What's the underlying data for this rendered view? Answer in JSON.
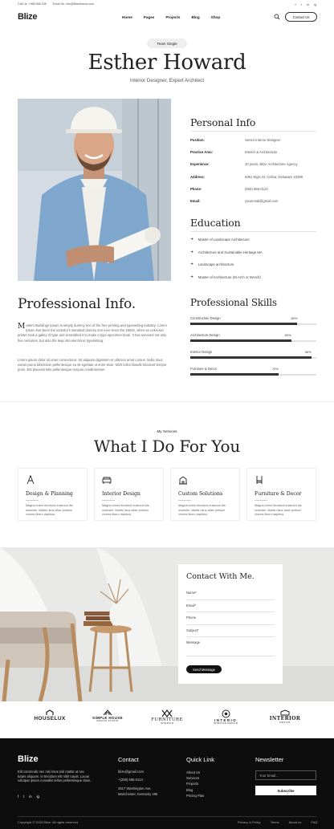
{
  "topbar": {
    "phone": "Call Us: +968 568 208",
    "email": "Email Us: Info@Blizetheme.com",
    "social": [
      "f",
      "t",
      "in",
      "ig"
    ]
  },
  "nav": {
    "logo": "Blize",
    "items": [
      "Home",
      "Pages",
      "Projects",
      "Blog",
      "Shop"
    ],
    "contact_label": "Contact Us"
  },
  "hero": {
    "badge": "Team Single",
    "name": "Esther Howard",
    "subtitle": "Interior Designer, Expert Architect"
  },
  "personal": {
    "title": "Personal Info",
    "rows": [
      {
        "k": "Position:",
        "v": "Senior Interior Designer"
      },
      {
        "k": "Practice Area:",
        "v": "Interior & Architecture"
      },
      {
        "k": "Experience:",
        "v": "10 years, Blize Architecture Agency"
      },
      {
        "k": "Address:",
        "v": "6391 Elgin St. Celina, Delaware 10299"
      },
      {
        "k": "Phone:",
        "v": "(603) 555-0123"
      },
      {
        "k": "Email:",
        "v": "youremail@gmail.com"
      }
    ]
  },
  "education": {
    "title": "Education",
    "items": [
      "Master of Landscape Architecture",
      "Architecture and Sustainable Heritage MA",
      "Landscape architecture",
      "Master of Architecture (M.Arch or MArch)"
    ]
  },
  "professional": {
    "title": "Professional Info.",
    "p1_drop": "M",
    "p1": "odern Buildings Ipsum is simply dummy text of the free printing and typesetting industry. Lorem Ipsum has been the industry's standard dummy text ever since the 1500s, when an unknown printer took a galley of type and scrambled it to make a type specimen book. It has survived not only five centuries, but also the leap into electronic typesetting.",
    "p2": "Lorem ipsum dolor sit amet consectetur. Sit aliquam dignissim et ultricies amet cursus. Nulla risus varius purus bibendum pellentesque eu sit egestas ut enim vitae. Nibh tortor blandit tincidunt tempor proin. Est placerat felis pellentesque tempus condimentum."
  },
  "skills": {
    "title": "Professional Skills",
    "items": [
      {
        "name": "Construction Design",
        "value": 85,
        "label": "85%"
      },
      {
        "name": "Architecture Design",
        "value": 80,
        "label": "80%"
      },
      {
        "name": "Interior Design",
        "value": 96,
        "label": "96%"
      },
      {
        "name": "Furniture & Decor",
        "value": 70,
        "label": "70%"
      }
    ]
  },
  "services": {
    "tag": "My Services",
    "title": "What I Do For You",
    "cards": [
      {
        "title": "Design & Planning",
        "desc": "Magna lorem tincidunt euismod dis molestie. Mattis risus vitae pretium viverra libero dapibus."
      },
      {
        "title": "Interior Design",
        "desc": "Magna lorem tincidunt euismod dis molestie. Mattis risus vitae pretium viverra libero dapibus."
      },
      {
        "title": "Custom Solutions",
        "desc": "Magna lorem tincidunt euismod dis molestie. Mattis risus vitae pretium viverra libero dapibus."
      },
      {
        "title": "Furniture & Decor",
        "desc": "Magna lorem tincidunt euismod dis molestie. Mattis risus vitae pretium viverra libero dapibus."
      }
    ]
  },
  "contact_form": {
    "title": "Contact With Me.",
    "fields": [
      "Name*",
      "Email*",
      "Phone",
      "Subject*",
      "Message"
    ],
    "submit": "Send Message"
  },
  "brands": [
    {
      "name": "HOUSELUX",
      "sub": ""
    },
    {
      "name": "SIMPLE HOUSE",
      "sub": "DESIGN STUDIO"
    },
    {
      "name": "FURNITURE",
      "sub": "INTERIOR"
    },
    {
      "name": "INTERIO",
      "sub": "INTERIOR DESIGN"
    },
    {
      "name": "INTERIOR",
      "sub": "DESIGN"
    }
  ],
  "footer": {
    "logo": "Blize",
    "about": "Elit commodo nec nisi risus nisl mattis ut nec turpis aliquam. In tincidunt elit nibh turpis. Lacus volutpat ipsum convallis tellus pellentesque diam.",
    "contact_title": "Contact",
    "contact": [
      "blize@gmail.com",
      "+(208) 555-0113",
      "4517 Washington Ave.",
      "Manchester, Kentucky 495"
    ],
    "quick_title": "Quick Link",
    "quick": [
      "About Us",
      "Services",
      "Projects",
      "Blog",
      "Pricing Plan"
    ],
    "newsletter_title": "Newsletter",
    "email_placeholder": "Your Email...",
    "subscribe": "Subscribe",
    "copyright": "Copyright © 2024 Blize. All rights reserved.",
    "bottom_links": [
      "Privacy & Policy",
      "Terms",
      "About us",
      "FAQ"
    ]
  },
  "colors": {
    "dark": "#0d0d0d",
    "accent": "#222222",
    "muted": "#666666"
  }
}
